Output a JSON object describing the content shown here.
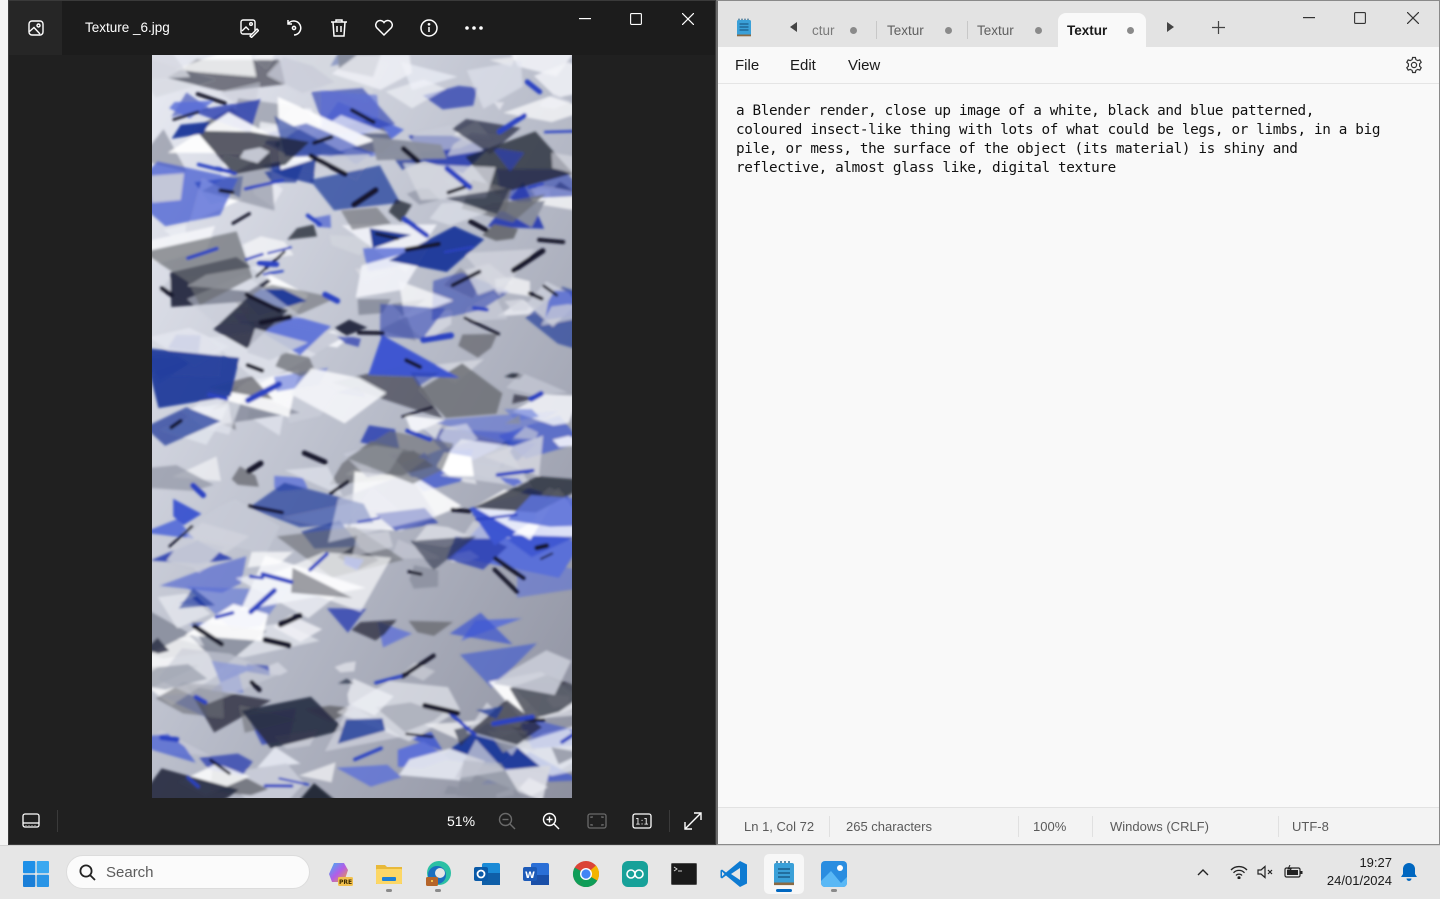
{
  "photos": {
    "filename": "Texture _6.jpg",
    "toolbar": {
      "icons": [
        "edit-image-icon",
        "rotate-icon",
        "delete-icon",
        "favorite-heart-icon",
        "info-icon",
        "more-options-icon"
      ]
    },
    "window_controls": [
      "minimize",
      "maximize",
      "close"
    ],
    "bottombar": {
      "zoom_level": "51%",
      "buttons": [
        "filmstrip",
        "zoom-out",
        "zoom-in",
        "fit-to-window",
        "actual-size-1-1",
        "full-screen"
      ],
      "actual_size_label": "1:1"
    },
    "image_description": "Blender render texture: white, black and blue patterned glassy shards"
  },
  "notepad": {
    "tabs": [
      {
        "label": "Textur",
        "visible_label": "ctur",
        "unsaved": true,
        "active": false
      },
      {
        "label": "Textur",
        "unsaved": true,
        "active": false
      },
      {
        "label": "Textur",
        "unsaved": true,
        "active": false
      },
      {
        "label": "Textur",
        "unsaved": true,
        "active": true
      }
    ],
    "new_tab_label": "+",
    "menu": [
      "File",
      "Edit",
      "View"
    ],
    "content_lines": [
      "a Blender render, close up image of a white, black and blue patterned,",
      "coloured insect-like thing with lots of what could be legs, or limbs, in a big",
      "pile, or mess, the surface of the object (its material) is shiny and",
      "reflective, almost glass like, digital texture"
    ],
    "status": {
      "position": "Ln 1, Col 72",
      "characters": "265 characters",
      "zoom": "100%",
      "line_ending": "Windows (CRLF)",
      "encoding": "UTF-8"
    }
  },
  "taskbar": {
    "search_placeholder": "Search",
    "apps": [
      {
        "name": "copilot-preview",
        "badge": "PRE",
        "running": false
      },
      {
        "name": "file-explorer",
        "running": true
      },
      {
        "name": "edge",
        "running": true
      },
      {
        "name": "outlook",
        "running": false
      },
      {
        "name": "word",
        "running": false
      },
      {
        "name": "chrome",
        "running": false
      },
      {
        "name": "arduino",
        "running": false
      },
      {
        "name": "terminal",
        "running": false
      },
      {
        "name": "vscode",
        "running": false
      },
      {
        "name": "notepad",
        "running": true,
        "active": true
      },
      {
        "name": "photos",
        "running": true
      }
    ],
    "tray": {
      "time": "19:27",
      "date": "24/01/2024"
    }
  },
  "colors": {
    "photos_bg": "#202020",
    "notepad_bg": "#f9f9f9",
    "accent": "#0067c0",
    "taskbar_bg": "#e6e6e6"
  }
}
